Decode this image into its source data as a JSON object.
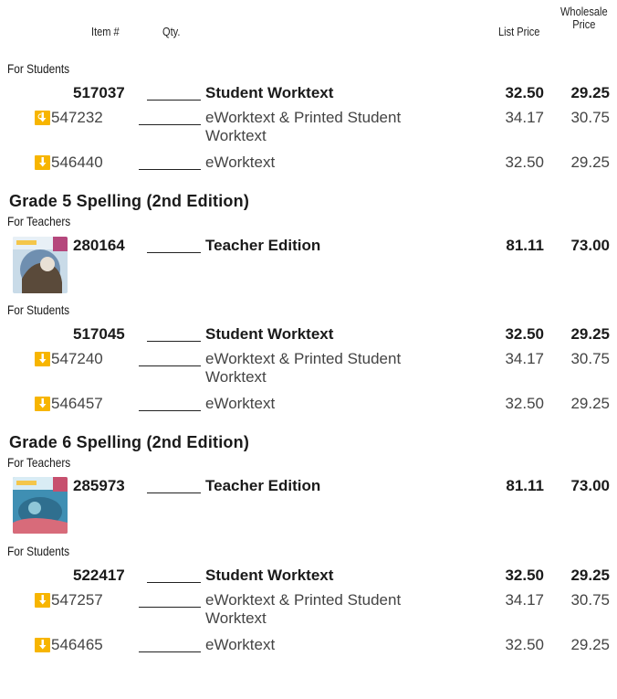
{
  "header": {
    "item": "Item #",
    "qty": "Qty.",
    "list_price": "List Price",
    "wholesale_line1": "Wholesale",
    "wholesale_line2": "Price"
  },
  "top": {
    "for_students": "For Students",
    "rows": [
      {
        "item": "517037",
        "desc": "Student Worktext",
        "list": "32.50",
        "wholesale": "29.25"
      },
      {
        "item": "547232",
        "desc": "eWorktext & Printed Student Worktext",
        "list": "34.17",
        "wholesale": "30.75"
      },
      {
        "item": "546440",
        "desc": "eWorktext",
        "list": "32.50",
        "wholesale": "29.25"
      }
    ]
  },
  "grade5": {
    "title": "Grade 5 Spelling (2nd Edition)",
    "for_teachers": "For Teachers",
    "teacher": {
      "item": "280164",
      "desc": "Teacher Edition",
      "list": "81.11",
      "wholesale": "73.00"
    },
    "for_students": "For Students",
    "rows": [
      {
        "item": "517045",
        "desc": "Student Worktext",
        "list": "32.50",
        "wholesale": "29.25"
      },
      {
        "item": "547240",
        "desc": "eWorktext & Printed Student Worktext",
        "list": "34.17",
        "wholesale": "30.75"
      },
      {
        "item": "546457",
        "desc": "eWorktext",
        "list": "32.50",
        "wholesale": "29.25"
      }
    ]
  },
  "grade6": {
    "title": "Grade 6 Spelling (2nd Edition)",
    "for_teachers": "For Teachers",
    "teacher": {
      "item": "285973",
      "desc": "Teacher Edition",
      "list": "81.11",
      "wholesale": "73.00"
    },
    "for_students": "For Students",
    "rows": [
      {
        "item": "522417",
        "desc": "Student Worktext",
        "list": "32.50",
        "wholesale": "29.25"
      },
      {
        "item": "547257",
        "desc": "eWorktext & Printed Student Worktext",
        "list": "34.17",
        "wholesale": "30.75"
      },
      {
        "item": "546465",
        "desc": "eWorktext",
        "list": "32.50",
        "wholesale": "29.25"
      }
    ]
  },
  "colors": {
    "icon_bg": "#f7b500",
    "text": "#1a1a1a",
    "subtext": "#444444"
  },
  "icons": {
    "digital": "e-worktext-download-icon",
    "cover5": "grade-5-cover-thumbnail",
    "cover6": "grade-6-cover-thumbnail"
  }
}
